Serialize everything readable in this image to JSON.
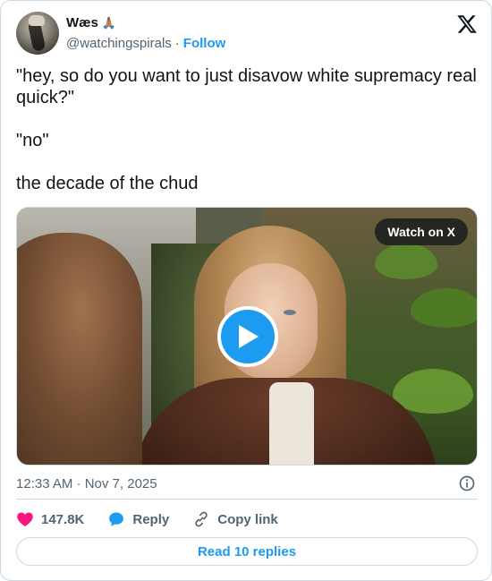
{
  "author": {
    "display_name": "Wæs",
    "name_emoji": "🙏🏽",
    "handle": "@watchingspirals",
    "separator": "·",
    "follow_label": "Follow"
  },
  "tweet": {
    "lines": [
      "\"hey, so do you want to just disavow white supremacy real quick?\"",
      "\"no\"",
      "the decade of the chud"
    ]
  },
  "media": {
    "watch_label": "Watch on X",
    "type": "video"
  },
  "meta": {
    "timestamp": "12:33 AM · Nov 7, 2025"
  },
  "actions": {
    "likes": "147.8K",
    "reply_label": "Reply",
    "copy_link_label": "Copy link"
  },
  "footer": {
    "read_replies_label": "Read 10 replies"
  },
  "colors": {
    "accent": "#1d9bf0",
    "like": "#f91880",
    "text": "#0f1419",
    "muted": "#536471",
    "border": "#cfd9de"
  }
}
